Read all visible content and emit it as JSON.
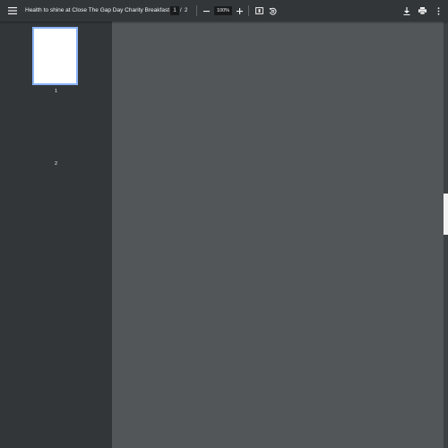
{
  "toolbar": {
    "title": "Health to shine at Close The Gap Day Charity Breakfast",
    "page_current": "1",
    "page_separator": "/",
    "page_total": "2",
    "zoom": "100%",
    "icons": [
      "menu-icon",
      "zoom-out-icon",
      "zoom-in-icon",
      "fit-page-icon",
      "rotate-icon",
      "download-icon",
      "print-icon",
      "more-vert-icon"
    ]
  },
  "sidebar": {
    "thumbnails": [
      {
        "label": "1"
      },
      {
        "label": "2"
      }
    ]
  },
  "colors": {
    "toolbar_bg": "#323639",
    "viewer_bg": "#525659",
    "selection": "#8ab4f8"
  }
}
